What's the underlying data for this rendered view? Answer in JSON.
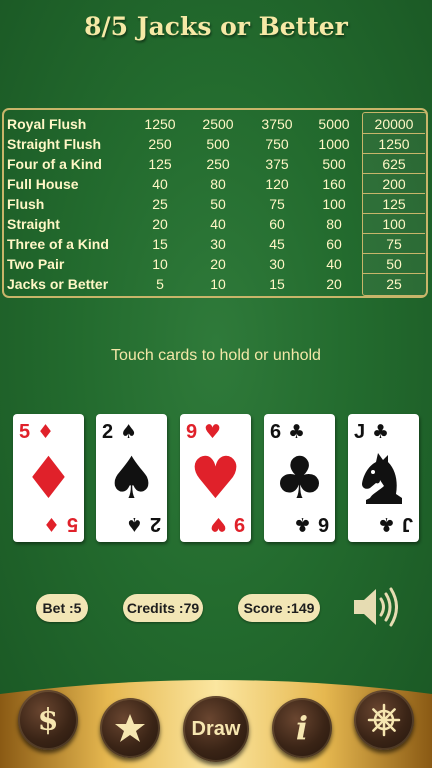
{
  "title": "8/5 Jacks or Better",
  "paytable": [
    {
      "hand": "Royal Flush",
      "p1": "1250",
      "p2": "2500",
      "p3": "3750",
      "p4": "5000",
      "p5": "20000"
    },
    {
      "hand": "Straight Flush",
      "p1": "250",
      "p2": "500",
      "p3": "750",
      "p4": "1000",
      "p5": "1250"
    },
    {
      "hand": "Four of a Kind",
      "p1": "125",
      "p2": "250",
      "p3": "375",
      "p4": "500",
      "p5": "625"
    },
    {
      "hand": "Full House",
      "p1": "40",
      "p2": "80",
      "p3": "120",
      "p4": "160",
      "p5": "200"
    },
    {
      "hand": "Flush",
      "p1": "25",
      "p2": "50",
      "p3": "75",
      "p4": "100",
      "p5": "125"
    },
    {
      "hand": "Straight",
      "p1": "20",
      "p2": "40",
      "p3": "60",
      "p4": "80",
      "p5": "100"
    },
    {
      "hand": "Three of a Kind",
      "p1": "15",
      "p2": "30",
      "p3": "45",
      "p4": "60",
      "p5": "75"
    },
    {
      "hand": "Two Pair",
      "p1": "10",
      "p2": "20",
      "p3": "30",
      "p4": "40",
      "p5": "50"
    },
    {
      "hand": "Jacks or Better",
      "p1": "5",
      "p2": "10",
      "p3": "15",
      "p4": "20",
      "p5": "25"
    }
  ],
  "hint": "Touch cards to hold or unhold",
  "cards": [
    {
      "rank": "5",
      "suit": "♦",
      "color": "red",
      "center": "♦"
    },
    {
      "rank": "2",
      "suit": "♠",
      "color": "black",
      "center": "♠"
    },
    {
      "rank": "9",
      "suit": "♥",
      "color": "red",
      "center": "♥"
    },
    {
      "rank": "6",
      "suit": "♣",
      "color": "black",
      "center": "♣"
    },
    {
      "rank": "J",
      "suit": "♣",
      "color": "black",
      "center": "knight"
    }
  ],
  "status": {
    "bet": "Bet :5",
    "credits": "Credits :79",
    "score": "Score :149"
  },
  "buttons": {
    "coin_icon": "dollar-icon",
    "star_icon": "star-icon",
    "draw_label": "Draw",
    "info_icon": "info-icon",
    "settings_icon": "ship-wheel-icon",
    "sound_icon": "speaker-icon"
  },
  "colors": {
    "felt": "#236b2e",
    "gold_text": "#f6e9a6",
    "table_border": "#c8b56a",
    "pill_bg": "#f2e6b5",
    "red_suit": "#e0212a"
  }
}
